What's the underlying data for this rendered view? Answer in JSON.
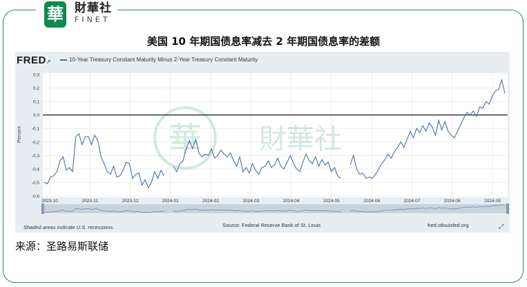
{
  "brand": {
    "name_cn": "財華社",
    "name_en": "FINET",
    "logo_char": "華"
  },
  "watermark": {
    "text": "財華社"
  },
  "title": "美国 10 年期国债息率减去 2 年期国债息率的差额",
  "source_label": "来源：圣路易斯联储",
  "fred": {
    "logo": "FRED",
    "legend": "10-Year Treasury Constant Maturity Minus 2-Year Treasury Constant Maturity",
    "shaded_note": "Shaded areas indicate U.S. recessions.",
    "source": "Source: Federal Reserve Bank of St. Louis",
    "site": "fred.stlouisfed.org",
    "expand_icon": "expand-icon"
  },
  "colors": {
    "line": "#4a6fa5",
    "frame": "#2e8b57",
    "panel": "#e8edf2",
    "zero_line": "#000000"
  },
  "chart_data": {
    "type": "line",
    "ylabel": "Percent",
    "ylim": [
      -0.6,
      0.3
    ],
    "yticks": [
      "0.3",
      "0.2",
      "0.1",
      "0.0",
      "-0.1",
      "-0.2",
      "-0.3",
      "-0.4",
      "-0.5",
      "-0.6"
    ],
    "xticks": [
      "2023-10",
      "2023-11",
      "2023-12",
      "2024-01",
      "2024-02",
      "2024-03",
      "2024-04",
      "2024-05",
      "2024-06",
      "2024-07",
      "2024-08",
      "2024-09"
    ],
    "x_start": "2023-10",
    "x_end": "2024-09",
    "grid": true,
    "reference_line": 0.0,
    "series": [
      {
        "values": [
          -0.5,
          -0.51,
          -0.46,
          -0.45,
          -0.42,
          -0.34,
          -0.31,
          -0.41,
          -0.39,
          -0.42,
          -0.16,
          -0.14,
          -0.22,
          -0.16,
          -0.16,
          -0.22,
          -0.15,
          -0.19,
          -0.31,
          -0.36,
          -0.42,
          -0.44,
          -0.38,
          -0.46,
          -0.45,
          -0.41,
          -0.35,
          -0.36,
          -0.47,
          -0.44,
          -0.43,
          -0.52,
          -0.48,
          -0.54,
          -0.5,
          -0.42,
          -0.47,
          -0.41,
          -0.45,
          null,
          null,
          -0.38,
          -0.42,
          -0.36,
          -0.34,
          -0.25,
          -0.19,
          -0.25,
          -0.18,
          -0.28,
          -0.31,
          -0.29,
          -0.3,
          -0.25,
          -0.32,
          -0.3,
          -0.26,
          -0.29,
          -0.31,
          -0.28,
          -0.34,
          -0.38,
          -0.31,
          -0.42,
          -0.39,
          -0.43,
          -0.36,
          -0.41,
          -0.44,
          -0.39,
          -0.38,
          -0.34,
          -0.39,
          -0.37,
          -0.32,
          -0.38,
          -0.4,
          -0.35,
          -0.3,
          -0.36,
          -0.4,
          -0.42,
          -0.35,
          -0.29,
          -0.34,
          -0.36,
          -0.31,
          -0.38,
          -0.33,
          -0.37,
          -0.35,
          -0.42,
          -0.39,
          -0.45,
          -0.47,
          null,
          null,
          -0.37,
          -0.3,
          -0.4,
          -0.44,
          -0.43,
          -0.47,
          -0.46,
          -0.47,
          -0.44,
          -0.4,
          -0.36,
          -0.33,
          -0.29,
          -0.32,
          -0.27,
          -0.24,
          -0.2,
          -0.24,
          -0.18,
          -0.12,
          -0.17,
          -0.1,
          -0.13,
          -0.08,
          -0.12,
          -0.06,
          -0.09,
          -0.15,
          -0.04,
          -0.11,
          -0.05,
          -0.12,
          -0.15,
          -0.17,
          -0.12,
          -0.07,
          -0.02,
          0.02,
          0.0,
          0.03,
          -0.01,
          0.06,
          0.05,
          0.1,
          0.08,
          0.14,
          0.18,
          0.19,
          0.26,
          0.16
        ]
      }
    ]
  }
}
